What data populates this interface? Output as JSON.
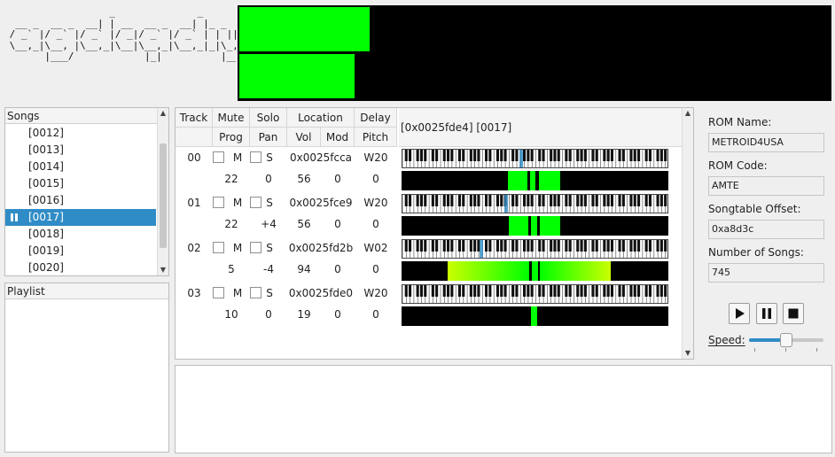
{
  "logo_ascii": "                  _              _\n  __ _  __ _  __| | __  __ _  __| |_ _  _\n / _` |/ _` |/ _` |/ _|/ _` |/ _` | | || |\n \\__,_|\\__, |\\__,_|\\__|\\__,_|\\__,_|_|\\_, |\n       |___/            |_|          |__/",
  "vu_levels": [
    0.22,
    0.195
  ],
  "songs": {
    "header": "Songs",
    "items": [
      {
        "label": "[0012]",
        "selected": false
      },
      {
        "label": "[0013]",
        "selected": false
      },
      {
        "label": "[0014]",
        "selected": false
      },
      {
        "label": "[0015]",
        "selected": false
      },
      {
        "label": "[0016]",
        "selected": false
      },
      {
        "label": "[0017]",
        "selected": true
      },
      {
        "label": "[0018]",
        "selected": false
      },
      {
        "label": "[0019]",
        "selected": false
      },
      {
        "label": "[0020]",
        "selected": false
      }
    ]
  },
  "playlist": {
    "header": "Playlist"
  },
  "tracker": {
    "headers_top": [
      "Track",
      "Mute",
      "Solo",
      "Location",
      "Delay"
    ],
    "headers_bottom": [
      "Prog",
      "Pan",
      "Vol",
      "Mod",
      "Pitch"
    ],
    "position_label": "[0x0025fde4] [0017]",
    "mute_label": "M",
    "solo_label": "S",
    "tracks": [
      {
        "track": "00",
        "location": "0x0025fcca",
        "delay": "W20",
        "prog": "22",
        "pan": "0",
        "vol": "56",
        "mod": "0",
        "pitch": "0"
      },
      {
        "track": "01",
        "location": "0x0025fce9",
        "delay": "W20",
        "prog": "22",
        "pan": "+4",
        "vol": "56",
        "mod": "0",
        "pitch": "0"
      },
      {
        "track": "02",
        "location": "0x0025fd2b",
        "delay": "W02",
        "prog": "5",
        "pan": "-4",
        "vol": "94",
        "mod": "0",
        "pitch": "0"
      },
      {
        "track": "03",
        "location": "0x0025fde0",
        "delay": "W20",
        "prog": "10",
        "pan": "0",
        "vol": "19",
        "mod": "0",
        "pitch": "0"
      }
    ]
  },
  "rom": {
    "name_label": "ROM Name:",
    "name_value": "METROID4USA",
    "code_label": "ROM Code:",
    "code_value": "AMTE",
    "offset_label": "Songtable Offset:",
    "offset_value": "0xa8d3c",
    "count_label": "Number of Songs:",
    "count_value": "745"
  },
  "playback": {
    "speed_label": "Speed:",
    "speed_level": 0.5
  },
  "colors": {
    "accent": "#308cc6",
    "meter_green": "#00ff00",
    "meter_yellow": "#ccff00"
  }
}
